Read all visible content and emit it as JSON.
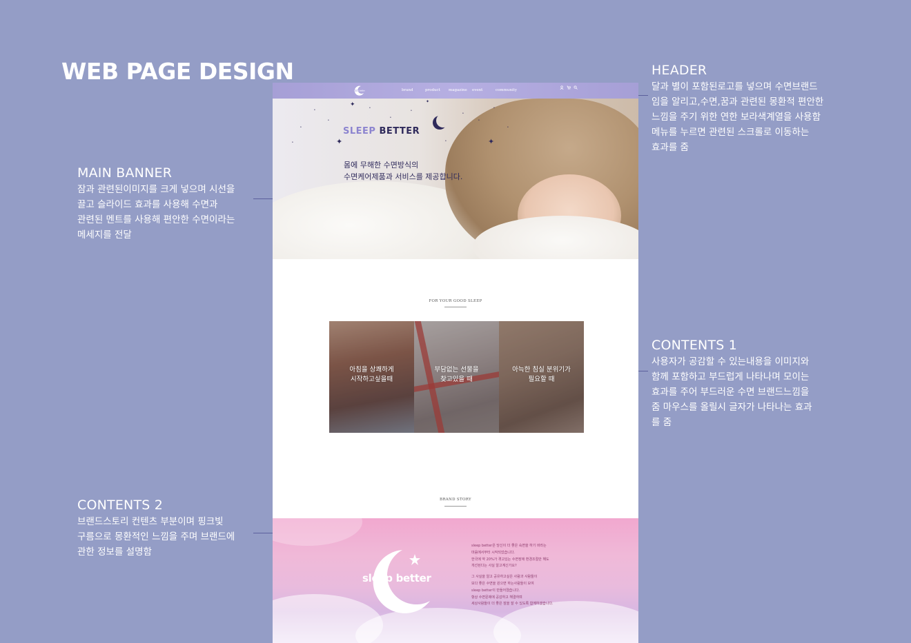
{
  "page_title": "WEB PAGE DESIGN",
  "annotations": {
    "header": {
      "title": "HEADER",
      "lines": [
        "달과 별이 포함된로고를 넣으며 수면브랜드",
        "임을 알리고,수면,꿈과 관련된 몽환적 편안한",
        "느낌을 주기 위한 연한 보라색계열을 사용함",
        "메뉴를 누르면 관련된 스크롤로 이동하는",
        "효과를 줌"
      ]
    },
    "main_banner": {
      "title": "MAIN BANNER",
      "lines": [
        "잠과 관련된이미지를 크게 넣으며 시선을",
        "끌고 슬라이드 효과를 사용해 수면과",
        "관련된 멘트를 사용해 편안한 수면이라는",
        "메세지를 전달"
      ]
    },
    "contents1": {
      "title": "CONTENTS 1",
      "lines": [
        "사용자가 공감할 수 있는내용을 이미지와",
        "함께 포함하고 부드럽게 나타나며 모이는",
        "효과를 주어  부드러운 수면 브랜드느낌을",
        "줌 마우스를  올릴시 글자가 나타나는 효과",
        "를 줌"
      ]
    },
    "contents2": {
      "title": "CONTENTS 2",
      "lines": [
        "브랜드스토리 컨텐츠 부분이며 핑크빛",
        "구름으로 몽환적인 느낌을 주며 브랜드에",
        "관한 정보를 설명함"
      ]
    }
  },
  "mock": {
    "nav": [
      "brand",
      "product",
      "magazine",
      "event",
      "community"
    ],
    "header_icons": [
      "user-icon",
      "cart-icon",
      "search-icon"
    ],
    "banner": {
      "brand_part1": "SLEEP",
      "brand_part2": "BETTER",
      "copy_line1": "몸에 무해한 수면방식의",
      "copy_line2": "수면케어제품과 서비스를 제공합니다."
    },
    "section1_label": "FOR YOUR GOOD SLEEP",
    "cards": [
      {
        "line1": "아침을 상쾌하게",
        "line2": "시작하고싶을때"
      },
      {
        "line1": "부담없는 선물을",
        "line2": "찾고있을 때"
      },
      {
        "line1": "아늑한 침실 분위기가",
        "line2": "필요할 때"
      }
    ],
    "section2_label": "BRAND STORY",
    "story": {
      "logo_text": "sleep better",
      "para1": [
        "sleep better은 당신이 더 좋은 숙면을 하기 바라는",
        "마음에서부터 시작되었습니다.",
        "한국에 약 20%가 겪고있는 수면장애 환경조절만 해도",
        "개선된다는 사실 알고계신가요?"
      ],
      "para2": [
        "그 사실을 알고 공유하고싶은 사람과 사람들이",
        "보다 좋은 수면을 원으면 하는사람들이 모여",
        "sleep better이 만들어졌습니다.",
        "항상 수면문제에 공감하고 해결하며",
        "세상사람들이 더 좋은 잠을 잘 수 있도록 함께하겠습니다."
      ]
    }
  },
  "colors": {
    "background": "#949dc6",
    "header_purple": "#a69fd6",
    "navy": "#2f2a5b",
    "connector": "#5b5f9c",
    "story_pink": "#f1a8cf"
  }
}
